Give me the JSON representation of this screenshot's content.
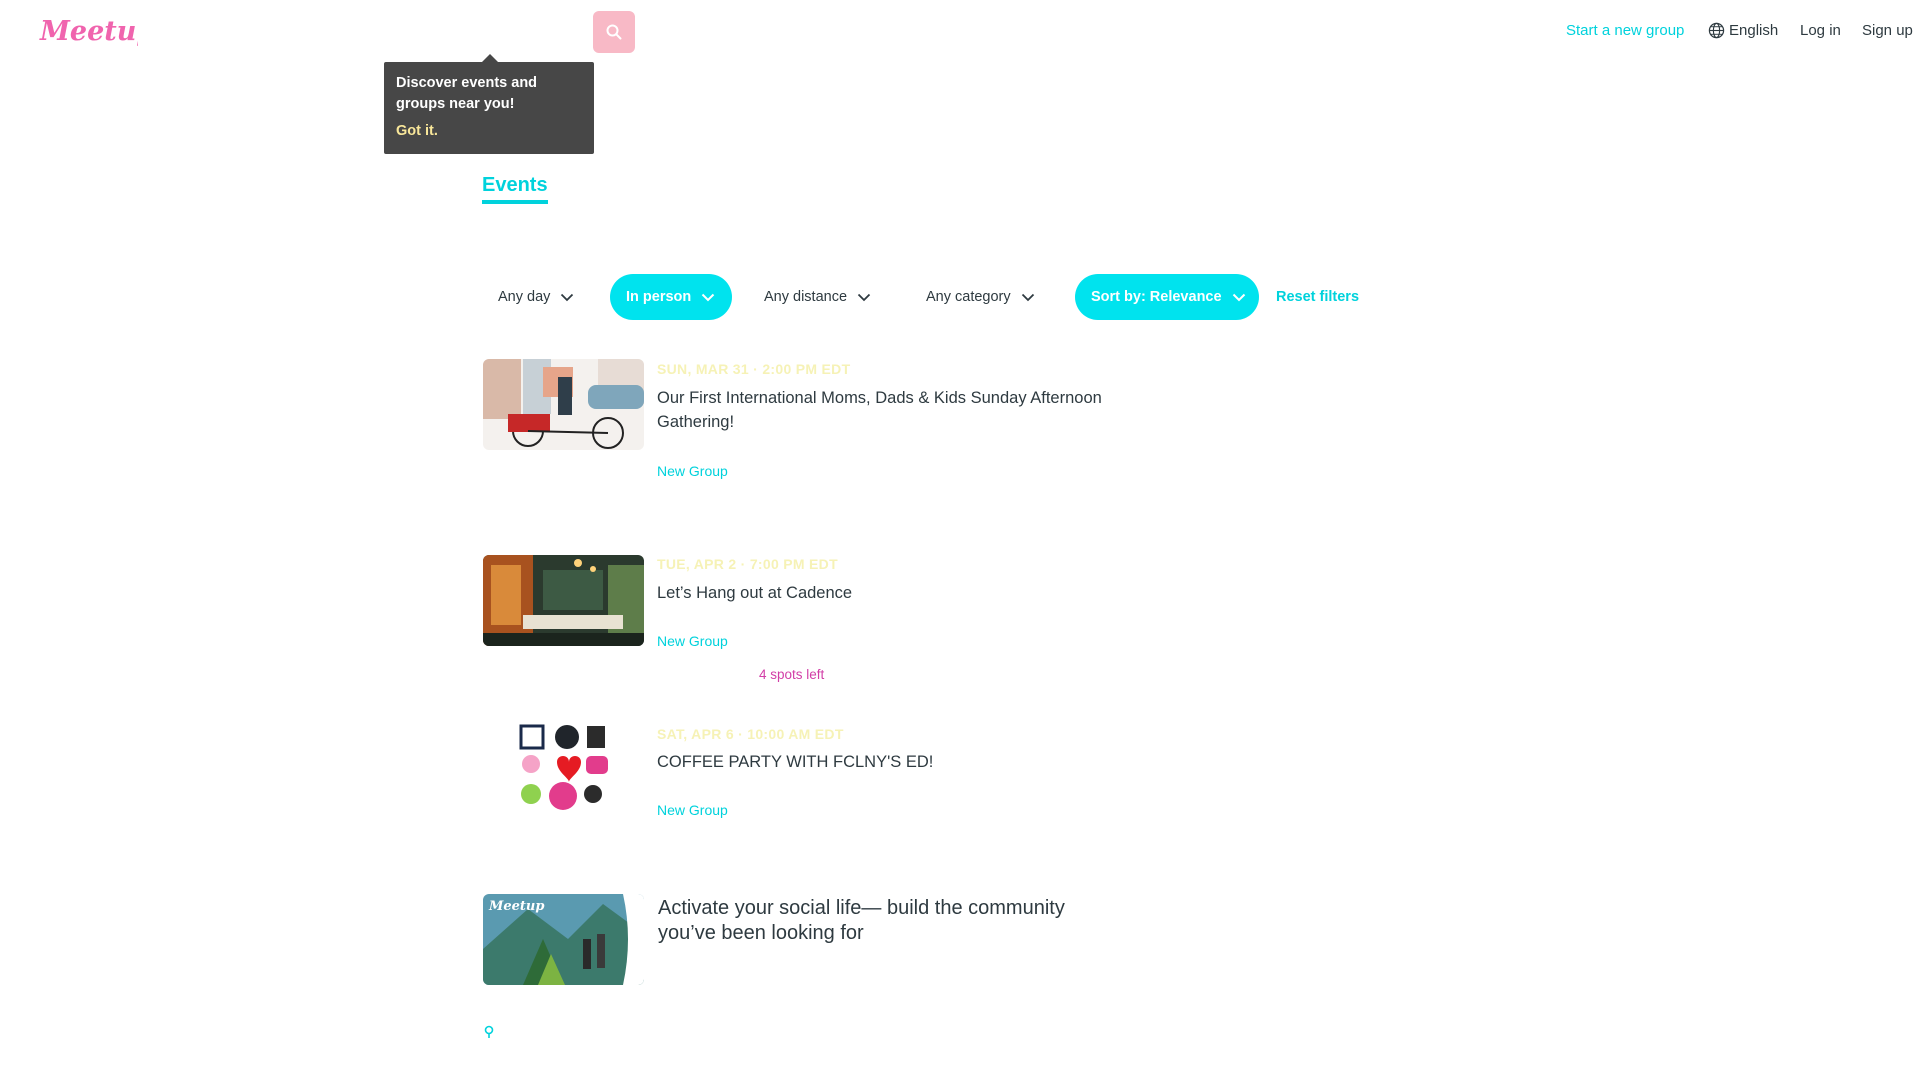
{
  "header": {
    "logo_text": "Meetup",
    "search": {
      "value": "",
      "placeholder": ""
    },
    "nav": {
      "start_group": "Start a new group",
      "language": "English",
      "login": "Log in",
      "signup": "Sign up"
    }
  },
  "tooltip": {
    "text": "Discover events and groups near you!",
    "action": "Got it."
  },
  "tabs": [
    {
      "label": "Events",
      "active": true
    }
  ],
  "filters": {
    "day": "Any day",
    "type": "In person",
    "distance": "Any distance",
    "category": "Any category",
    "sort": "Sort by: Relevance",
    "reset": "Reset filters"
  },
  "events": [
    {
      "date": "SUN, MAR 31 · 2:00 PM EDT",
      "title": "Our First International Moms, Dads & Kids Sunday Afternoon Gathering!",
      "group": "New Group"
    },
    {
      "date": "TUE, APR 2 · 7:00 PM EDT",
      "title": "Let’s Hang out at Cadence",
      "group": "New Group",
      "spots": "4 spots left"
    },
    {
      "date": "SAT, APR 6 · 10:00 AM EDT",
      "title": "COFFEE PARTY WITH FCLNY'S ED!",
      "group": "New Group"
    }
  ],
  "promo": {
    "logo_text": "Meetup",
    "title": "Activate your social life— build the community you’ve been looking for"
  },
  "colors": {
    "brand_teal": "#00d2dc",
    "brand_pink": "#f65858",
    "tooltip_bg": "#474747"
  }
}
